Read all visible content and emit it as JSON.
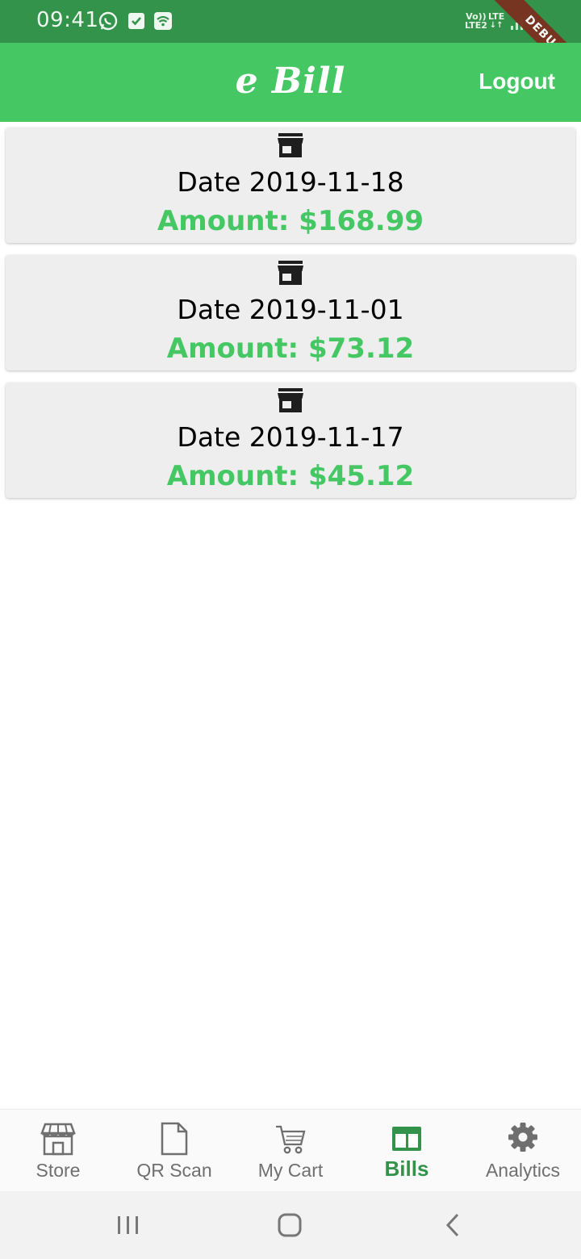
{
  "status_bar": {
    "time": "09:41",
    "volte_label": "Vo))",
    "lte2_label": "LTE2",
    "lte_label": "LTE",
    "debug_label": "DEBUG"
  },
  "app_bar": {
    "title": "e Bill",
    "logout_label": "Logout"
  },
  "bills": [
    {
      "date": "Date 2019-11-18",
      "amount": "Amount: $168.99"
    },
    {
      "date": "Date 2019-11-01",
      "amount": "Amount: $73.12"
    },
    {
      "date": "Date 2019-11-17",
      "amount": "Amount: $45.12"
    }
  ],
  "bottom_nav": {
    "items": [
      {
        "label": "Store",
        "icon": "store-icon"
      },
      {
        "label": "QR Scan",
        "icon": "document-icon"
      },
      {
        "label": "My Cart",
        "icon": "cart-icon"
      },
      {
        "label": "Bills",
        "icon": "bills-icon",
        "active": true
      },
      {
        "label": "Analytics",
        "icon": "gear-icon"
      }
    ]
  },
  "colors": {
    "status_bar": "#34934a",
    "app_bar": "#45c764",
    "accent_text": "#45c764",
    "card_bg": "#eeeeee",
    "active_nav": "#34934a"
  }
}
